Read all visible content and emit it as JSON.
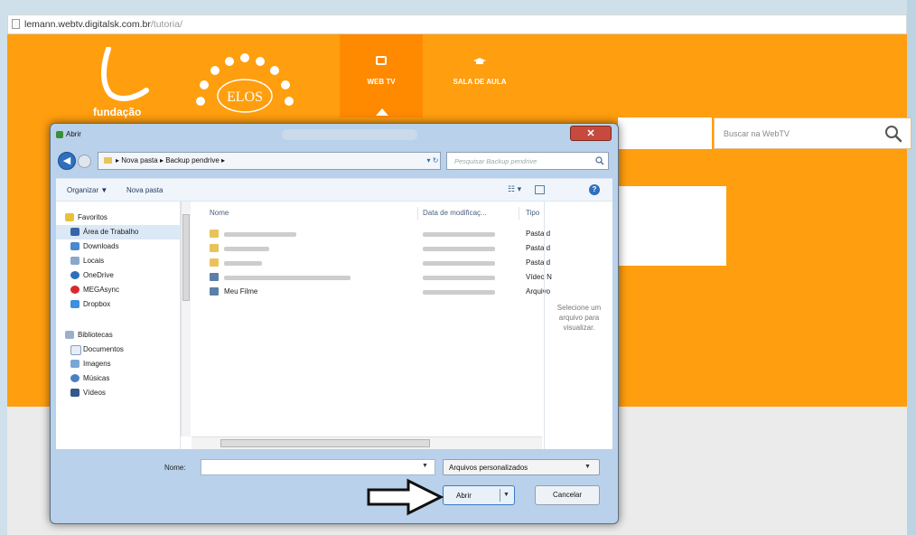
{
  "browser": {
    "url_host": "lemann.webtv.digitalsk.com.br",
    "url_path": "/tutoria/"
  },
  "site": {
    "logo_text": "fundação",
    "logo_elos_text": "ELOS",
    "nav": [
      {
        "label": "WEB TV",
        "icon": "tv-icon",
        "active": true
      },
      {
        "label": "SALA DE AULA",
        "icon": "graduation-cap-icon",
        "active": false
      }
    ],
    "search_placeholder": "Buscar na WebTV"
  },
  "dialog": {
    "title": "Abrir",
    "close_glyph": "✕",
    "breadcrumbs": [
      "Nova pasta",
      "Backup pendrive"
    ],
    "search_placeholder": "Pesquisar Backup pendrive",
    "toolbar": {
      "organize": "Organizar ▼",
      "new_folder": "Nova pasta"
    },
    "nav_favorites": [
      {
        "label": "Favoritos",
        "icon": "star-icon"
      },
      {
        "label": "Área de Trabalho",
        "icon": "desktop-icon"
      },
      {
        "label": "Downloads",
        "icon": "downloads-icon"
      },
      {
        "label": "Locais",
        "icon": "places-icon"
      },
      {
        "label": "OneDrive",
        "icon": "cloud-icon"
      },
      {
        "label": "MEGAsync",
        "icon": "mega-icon"
      },
      {
        "label": "Dropbox",
        "icon": "dropbox-icon"
      }
    ],
    "nav_libraries": [
      {
        "label": "Bibliotecas",
        "icon": "libraries-icon"
      },
      {
        "label": "Documentos",
        "icon": "documents-icon"
      },
      {
        "label": "Imagens",
        "icon": "images-icon"
      },
      {
        "label": "Músicas",
        "icon": "music-icon"
      },
      {
        "label": "Vídeos",
        "icon": "videos-icon"
      }
    ],
    "columns": {
      "name": "Nome",
      "date": "Data de modificaç...",
      "type": "Tipo"
    },
    "files": [
      {
        "name": "",
        "type": "Pasta d",
        "kind": "folder"
      },
      {
        "name": "",
        "type": "Pasta d",
        "kind": "folder"
      },
      {
        "name": "",
        "type": "Pasta d",
        "kind": "folder"
      },
      {
        "name": "",
        "type": "Vídeo N",
        "kind": "video"
      },
      {
        "name": "Meu Filme",
        "type": "Arquivo",
        "kind": "video"
      }
    ],
    "preview_message": "Selecione um arquivo para visualizar.",
    "name_label": "Nome:",
    "name_value": "",
    "filter_value": "Arquivos personalizados",
    "open_label": "Abrir",
    "cancel_label": "Cancelar"
  },
  "colors": {
    "site_orange": "#ff9e0e",
    "dialog_frame": "#b9d1ea",
    "close_red": "#c74a3e"
  }
}
